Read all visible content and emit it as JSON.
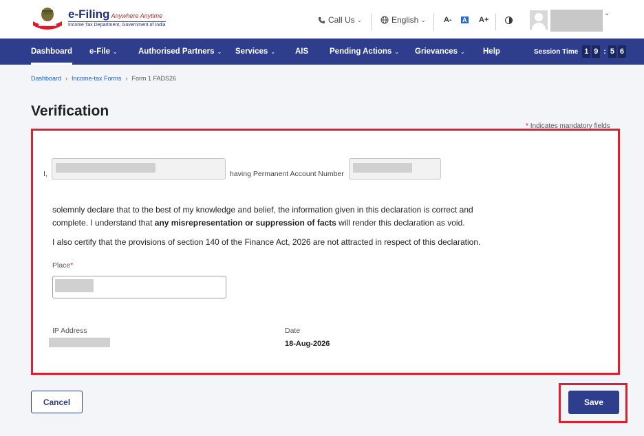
{
  "header": {
    "logo_title": "e-Filing",
    "logo_tagline": "Anywhere Anytime",
    "logo_subtitle": "Income Tax Department, Government of India",
    "call_us": "Call Us",
    "language": "English",
    "font_decrease": "A-",
    "font_normal": "A",
    "font_increase": "A+"
  },
  "nav": {
    "items": [
      {
        "label": "Dashboard",
        "has_dropdown": false,
        "active": true
      },
      {
        "label": "e-File",
        "has_dropdown": true
      },
      {
        "label": "Authorised Partners",
        "has_dropdown": true
      },
      {
        "label": "Services",
        "has_dropdown": true
      },
      {
        "label": "AIS",
        "has_dropdown": false
      },
      {
        "label": "Pending Actions",
        "has_dropdown": true
      },
      {
        "label": "Grievances",
        "has_dropdown": true
      },
      {
        "label": "Help",
        "has_dropdown": false
      }
    ],
    "session_label": "Session Time",
    "session_digits": [
      "1",
      "9",
      "5",
      "6"
    ]
  },
  "breadcrumb": {
    "items": [
      "Dashboard",
      "Income-tax Forms",
      "Form 1 FADS26"
    ]
  },
  "page": {
    "title": "Verification",
    "mandatory_note": "Indicates mandatory fields",
    "mandatory_star": "*"
  },
  "declaration": {
    "prefix": "I,",
    "pan_label": "having Permanent Account Number",
    "text_part1": "solemnly declare that to the best of my knowledge and belief, the information given in this declaration is correct and complete. I understand that ",
    "text_bold": "any misrepresentation or suppression of facts",
    "text_part2": " will render this declaration as void.",
    "certify": "I also certify that the provisions of section 140 of the Finance Act, 2026 are not attracted in respect of this declaration.",
    "place_label": "Place",
    "place_required": "*",
    "ip_label": "IP Address",
    "date_label": "Date",
    "date_value": "18-Aug-2026"
  },
  "actions": {
    "cancel_label": "Cancel",
    "save_label": "Save"
  },
  "colors": {
    "primary": "#2f3d8d",
    "highlight": "#e21d2c"
  }
}
